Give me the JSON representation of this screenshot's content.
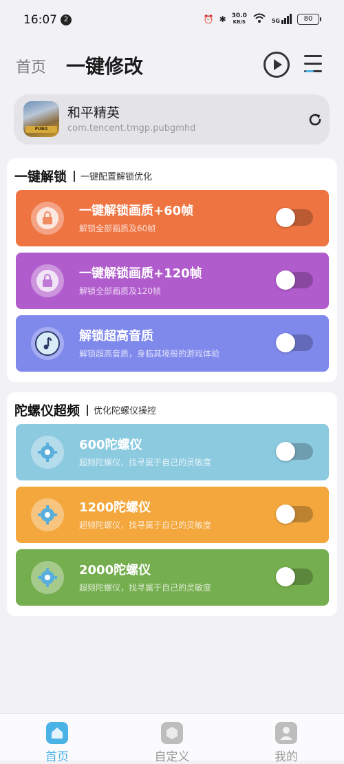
{
  "status_bar": {
    "time": "16:07",
    "notification_count": "2",
    "net_speed_value": "30.0",
    "net_speed_unit": "KB/S",
    "signal_label": "5G",
    "battery": "80"
  },
  "header": {
    "home_link": "首页",
    "title": "一键修改"
  },
  "app": {
    "name": "和平精英",
    "package": "com.tencent.tmgp.pubgmhd",
    "icon_text": "PUBG"
  },
  "sections": [
    {
      "title": "一键解锁",
      "subtitle": "一键配置解锁优化",
      "items": [
        {
          "title": "一键解锁画质+60帧",
          "subtitle": "解锁全部画质及60帧",
          "color": "#ee7442",
          "icon": "lock-icon",
          "enabled": false
        },
        {
          "title": "一键解锁画质+120帧",
          "subtitle": "解锁全部画质及120帧",
          "color": "#b15ccd",
          "icon": "lock-icon",
          "enabled": false
        },
        {
          "title": "解锁超高音质",
          "subtitle": "解锁超高音质，身临其境般的游戏体验",
          "color": "#7f89ec",
          "icon": "music-icon",
          "enabled": false
        }
      ]
    },
    {
      "title": "陀螺仪超频",
      "subtitle": "优化陀螺仪操控",
      "items": [
        {
          "title": "600陀螺仪",
          "subtitle": "超频陀螺仪，找寻属于自己的灵敏度",
          "color": "#8ccae0",
          "icon": "gear-icon",
          "enabled": false
        },
        {
          "title": "1200陀螺仪",
          "subtitle": "超频陀螺仪，找寻属于自己的灵敏度",
          "color": "#f3a73d",
          "icon": "gear-icon",
          "enabled": false
        },
        {
          "title": "2000陀螺仪",
          "subtitle": "超频陀螺仪，找寻属于自己的灵敏度",
          "color": "#75ae4f",
          "icon": "gear-icon",
          "enabled": false
        }
      ]
    }
  ],
  "bottom_nav": [
    {
      "label": "首页",
      "active": true,
      "color": "#4bb2e6",
      "icon": "home-icon"
    },
    {
      "label": "自定义",
      "active": false,
      "color": "#bdbdbd",
      "icon": "customize-icon"
    },
    {
      "label": "我的",
      "active": false,
      "color": "#bdbdbd",
      "icon": "user-icon"
    }
  ]
}
